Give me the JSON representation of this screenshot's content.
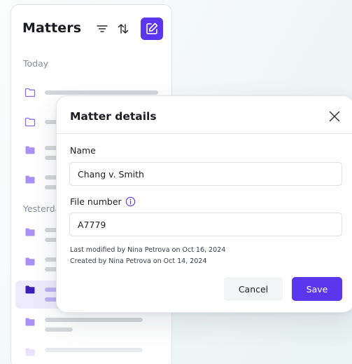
{
  "sidebar": {
    "title": "Matters",
    "icons": {
      "filter": "filter-icon",
      "sort": "sort-icon",
      "new": "new-matter-icon"
    },
    "sections": [
      {
        "label": "Today"
      },
      {
        "label": "Yesterday"
      }
    ]
  },
  "modal": {
    "title": "Matter details",
    "name_label": "Name",
    "name_value": "Chang v. Smith",
    "file_number_label": "File number",
    "file_number_value": "A7779",
    "last_modified": "Last modified by Nina Petrova on Oct 16, 2024",
    "created": "Created by Nina Petrova on Oct 14, 2024",
    "cancel_label": "Cancel",
    "save_label": "Save"
  },
  "colors": {
    "accent": "#5a37ef",
    "folder_outline": "#8a6cf5",
    "folder_filled": "#a98ff7",
    "folder_active": "#3b1fb8",
    "skeleton": "#d4d6db"
  }
}
